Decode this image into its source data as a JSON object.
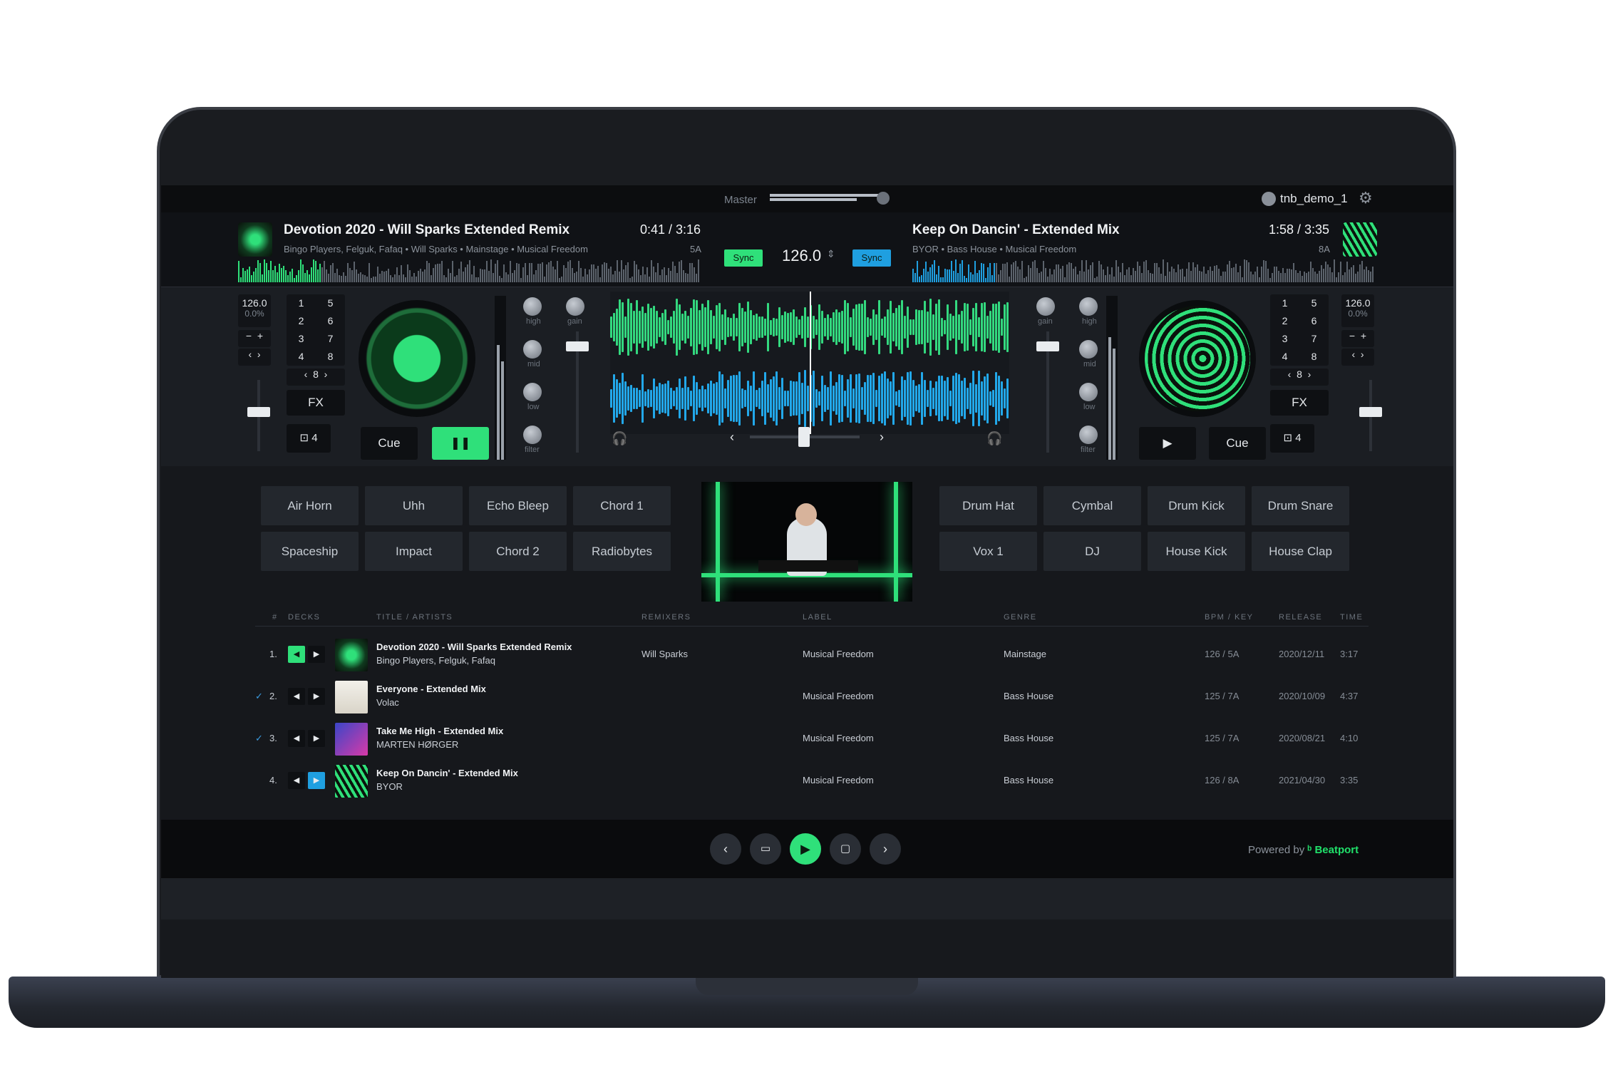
{
  "topbar": {
    "master_label": "Master",
    "user": "tnb_demo_1"
  },
  "deck_a": {
    "title": "Devotion 2020 - Will Sparks Extended Remix",
    "subtitle": "Bingo Players, Felguk, Fafaq • Will Sparks • Mainstage • Musical Freedom",
    "time": "0:41 / 3:16",
    "key": "5A",
    "bpm": "126.0",
    "pitch": "0.0%",
    "cue_label": "Cue",
    "fx_label": "FX",
    "loop_value": "8",
    "beat_value": "4",
    "pads": [
      "1",
      "5",
      "2",
      "6",
      "3",
      "7",
      "4",
      "8"
    ]
  },
  "deck_b": {
    "title": "Keep On Dancin' - Extended Mix",
    "subtitle": "BYOR • Bass House • Musical Freedom",
    "time": "1:58 / 3:35",
    "key": "8A",
    "bpm": "126.0",
    "pitch": "0.0%",
    "cue_label": "Cue",
    "fx_label": "FX",
    "loop_value": "8",
    "beat_value": "4",
    "pads": [
      "1",
      "5",
      "2",
      "6",
      "3",
      "7",
      "4",
      "8"
    ]
  },
  "center": {
    "sync_left": "Sync",
    "sync_right": "Sync",
    "bpm": "126.0"
  },
  "eq_labels": {
    "high": "high",
    "mid": "mid",
    "low": "low",
    "filter": "filter",
    "gain": "gain"
  },
  "sampler_left": [
    "Air Horn",
    "Uhh",
    "Echo Bleep",
    "Chord 1",
    "Spaceship",
    "Impact",
    "Chord 2",
    "Radiobytes"
  ],
  "sampler_right": [
    "Drum Hat",
    "Cymbal",
    "Drum Kick",
    "Drum Snare",
    "Vox 1",
    "DJ",
    "House Kick",
    "House Clap"
  ],
  "table": {
    "headers": [
      "#",
      "DECKS",
      "TITLE / ARTISTS",
      "REMIXERS",
      "LABEL",
      "GENRE",
      "BPM / KEY",
      "RELEASE",
      "TIME"
    ],
    "rows": [
      {
        "num": "1.",
        "title": "Devotion 2020 - Will Sparks Extended Remix",
        "artists": "Bingo Players, Felguk, Fafaq",
        "remixers": "Will Sparks",
        "label": "Musical Freedom",
        "genre": "Mainstage",
        "bpmkey": "126 / 5A",
        "release": "2020/12/11",
        "time": "3:17"
      },
      {
        "num": "2.",
        "title": "Everyone - Extended Mix",
        "artists": "Volac",
        "remixers": "",
        "label": "Musical Freedom",
        "genre": "Bass House",
        "bpmkey": "125 / 7A",
        "release": "2020/10/09",
        "time": "4:37"
      },
      {
        "num": "3.",
        "title": "Take Me High - Extended Mix",
        "artists": "MARTEN HØRGER",
        "remixers": "",
        "label": "Musical Freedom",
        "genre": "Bass House",
        "bpmkey": "125 / 7A",
        "release": "2020/08/21",
        "time": "4:10"
      },
      {
        "num": "4.",
        "title": "Keep On Dancin' - Extended Mix",
        "artists": "BYOR",
        "remixers": "",
        "label": "Musical Freedom",
        "genre": "Bass House",
        "bpmkey": "126 / 8A",
        "release": "2021/04/30",
        "time": "3:35"
      }
    ]
  },
  "footer": {
    "powered_by": "Powered by",
    "brand": "Beatport"
  },
  "colors": {
    "accent_green": "#2fe07a",
    "accent_blue": "#1f9fe0",
    "background": "#16181c"
  }
}
